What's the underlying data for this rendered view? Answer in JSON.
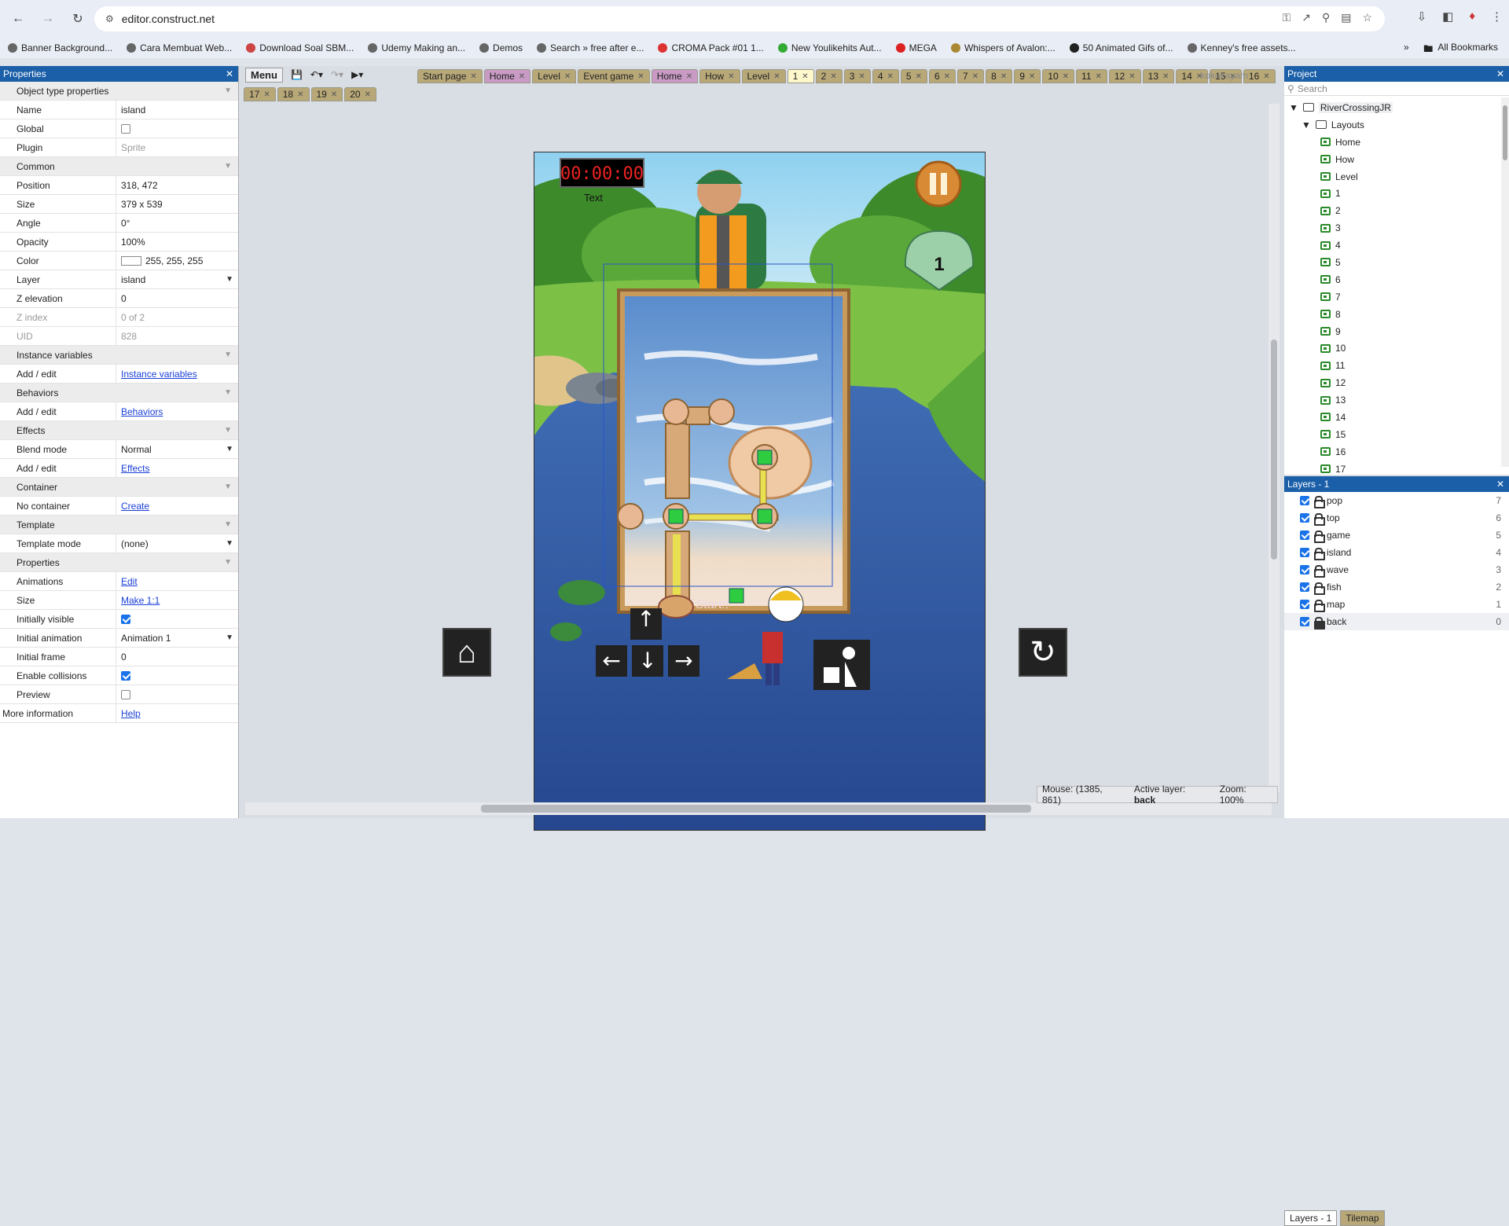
{
  "browser": {
    "url": "editor.construct.net",
    "bookmarks": [
      "Banner Background...",
      "Cara Membuat Web...",
      "Download Soal SBM...",
      "Udemy Making an...",
      "Demos",
      "Search » free after e...",
      "CROMA Pack #01 1...",
      "New Youlikehits Aut...",
      "MEGA",
      "Whispers of Avalon:...",
      "50 Animated Gifs of...",
      "Kenney's free assets..."
    ],
    "all_bookmarks": "All Bookmarks"
  },
  "properties": {
    "title": "Properties",
    "rows": [
      {
        "type": "cat",
        "label": "Object type properties"
      },
      {
        "type": "text",
        "key": "Name",
        "value": "island"
      },
      {
        "type": "check",
        "key": "Global",
        "checked": false
      },
      {
        "type": "dim",
        "key": "Plugin",
        "value": "Sprite"
      },
      {
        "type": "cat",
        "label": "Common"
      },
      {
        "type": "expand",
        "key": "Position",
        "value": "318, 472"
      },
      {
        "type": "expand",
        "key": "Size",
        "value": "379 x 539"
      },
      {
        "type": "text",
        "key": "Angle",
        "value": "0°"
      },
      {
        "type": "text",
        "key": "Opacity",
        "value": "100%"
      },
      {
        "type": "color",
        "key": "Color",
        "value": "255, 255, 255"
      },
      {
        "type": "select",
        "key": "Layer",
        "value": "island"
      },
      {
        "type": "text",
        "key": "Z elevation",
        "value": "0"
      },
      {
        "type": "dimkey",
        "key": "Z index",
        "value": "0 of 2"
      },
      {
        "type": "dimkey",
        "key": "UID",
        "value": "828"
      },
      {
        "type": "cat",
        "label": "Instance variables"
      },
      {
        "type": "link",
        "key": "Add / edit",
        "value": "Instance variables"
      },
      {
        "type": "cat",
        "label": "Behaviors"
      },
      {
        "type": "link",
        "key": "Add / edit",
        "value": "Behaviors"
      },
      {
        "type": "cat",
        "label": "Effects"
      },
      {
        "type": "select",
        "key": "Blend mode",
        "value": "Normal"
      },
      {
        "type": "link",
        "key": "Add / edit",
        "value": "Effects"
      },
      {
        "type": "cat",
        "label": "Container"
      },
      {
        "type": "link",
        "key": "No container",
        "value": "Create"
      },
      {
        "type": "cat",
        "label": "Template"
      },
      {
        "type": "select",
        "key": "Template mode",
        "value": "(none)"
      },
      {
        "type": "cat",
        "label": "Properties"
      },
      {
        "type": "link",
        "key": "Animations",
        "value": "Edit"
      },
      {
        "type": "link",
        "key": "Size",
        "value": "Make 1:1"
      },
      {
        "type": "check",
        "key": "Initially visible",
        "checked": true
      },
      {
        "type": "select",
        "key": "Initial animation",
        "value": "Animation 1"
      },
      {
        "type": "text",
        "key": "Initial frame",
        "value": "0"
      },
      {
        "type": "check",
        "key": "Enable collisions",
        "checked": true
      },
      {
        "type": "check",
        "key": "Preview",
        "checked": false
      },
      {
        "type": "info",
        "key": "More information",
        "value": "Help"
      }
    ]
  },
  "toolbar": {
    "menu_label": "Menu",
    "tabs": [
      "Start page",
      "Home",
      "Level",
      "Event game",
      "Home",
      "How",
      "Level",
      "1",
      "2",
      "3",
      "4",
      "5",
      "6",
      "7",
      "8",
      "9",
      "10",
      "11",
      "12",
      "13",
      "14",
      "15",
      "16"
    ],
    "active_tab": "1",
    "tabs_row2": [
      "17",
      "18",
      "19",
      "20"
    ],
    "owner": "kokokayam"
  },
  "game": {
    "timer": "00:00:00",
    "text_object": "Text",
    "shell_number": "1",
    "start_label": "Start!!"
  },
  "status": {
    "mouse": "Mouse: (1385, 861)",
    "active_layer_label": "Active layer:",
    "active_layer": "back",
    "zoom": "Zoom: 100%"
  },
  "project": {
    "title": "Project",
    "search_placeholder": "Search",
    "root": "RiverCrossingJR",
    "folder": "Layouts",
    "layouts": [
      "Home",
      "How",
      "Level",
      "1",
      "2",
      "3",
      "4",
      "5",
      "6",
      "7",
      "8",
      "9",
      "10",
      "11",
      "12",
      "13",
      "14",
      "15",
      "16",
      "17"
    ]
  },
  "layers": {
    "title": "Layers - 1",
    "items": [
      {
        "name": "pop",
        "num": "7",
        "locked": false
      },
      {
        "name": "top",
        "num": "6",
        "locked": false
      },
      {
        "name": "game",
        "num": "5",
        "locked": false
      },
      {
        "name": "island",
        "num": "4",
        "locked": false
      },
      {
        "name": "wave",
        "num": "3",
        "locked": false
      },
      {
        "name": "fish",
        "num": "2",
        "locked": false
      },
      {
        "name": "map",
        "num": "1",
        "locked": false
      },
      {
        "name": "back",
        "num": "0",
        "locked": true
      }
    ],
    "bottom_tabs": [
      "Layers - 1",
      "Tilemap"
    ]
  }
}
